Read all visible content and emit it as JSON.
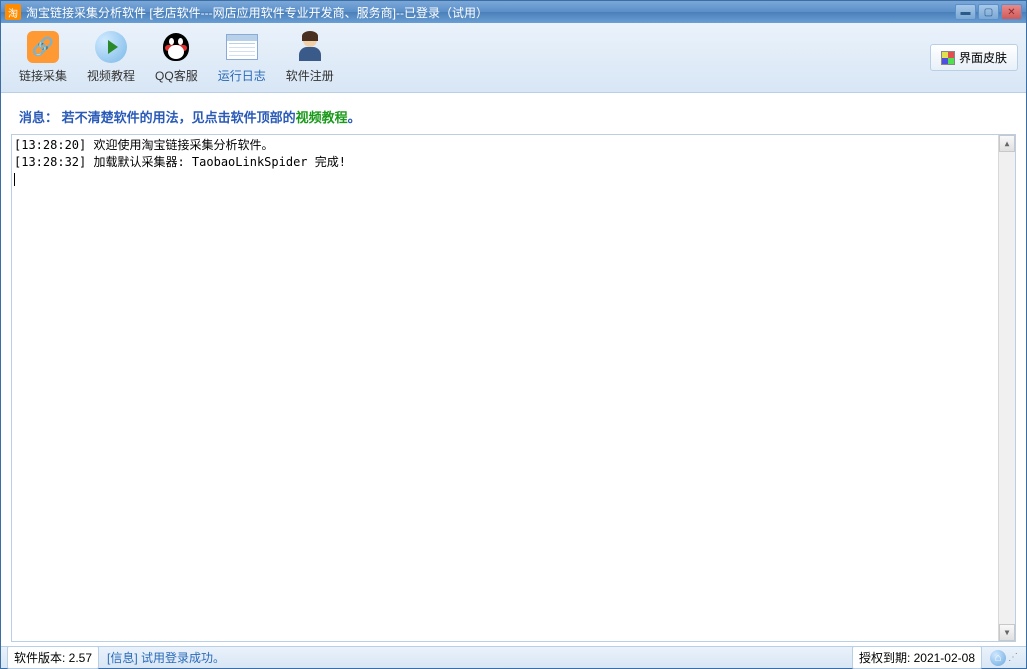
{
  "titlebar": {
    "title": "淘宝链接采集分析软件 [老店软件---网店应用软件专业开发商、服务商]--已登录（试用）"
  },
  "toolbar": {
    "items": [
      {
        "label": "链接采集"
      },
      {
        "label": "视频教程"
      },
      {
        "label": "QQ客服"
      },
      {
        "label": "运行日志"
      },
      {
        "label": "软件注册"
      }
    ],
    "skin_label": "界面皮肤"
  },
  "message": {
    "prefix": "消息：",
    "text1": " 若不清楚软件的用法，见点击软件顶部的",
    "text2": "视频教程",
    "suffix": "。"
  },
  "log": {
    "lines": [
      "[13:28:20] 欢迎使用淘宝链接采集分析软件。",
      "[13:28:32] 加载默认采集器: TaobaoLinkSpider 完成!"
    ]
  },
  "status": {
    "version_label": "软件版本: ",
    "version": "2.57",
    "info_label": "[信息] ",
    "info_text": "试用登录成功。",
    "license_label": "授权到期: ",
    "license_date": "2021-02-08"
  }
}
